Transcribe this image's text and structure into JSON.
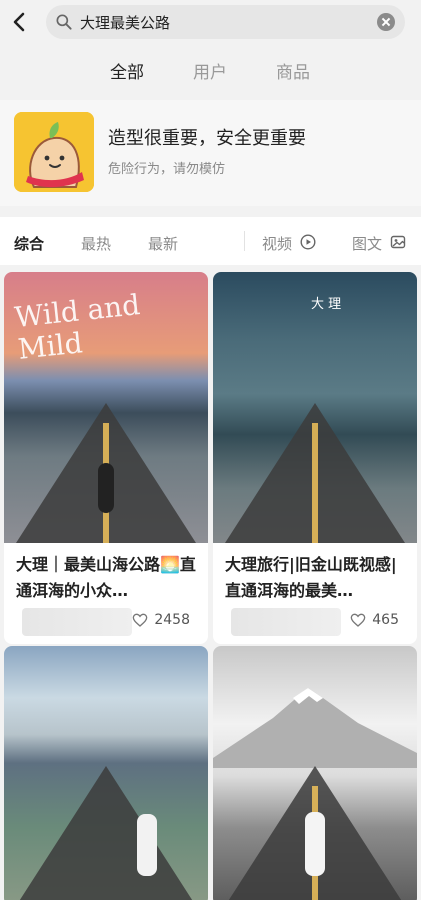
{
  "search": {
    "query": "大理最美公路"
  },
  "tabs": {
    "all": "全部",
    "users": "用户",
    "products": "商品"
  },
  "promo": {
    "title": "造型很重要，安全更重要",
    "subtitle": "危险行为，请勿模仿"
  },
  "filters": {
    "comprehensive": "综合",
    "hottest": "最热",
    "newest": "最新",
    "video": "视频",
    "image_text": "图文"
  },
  "cards": [
    {
      "title": "大理｜最美山海公路🌅直通洱海的小众…",
      "likes": "2458",
      "overlay_title": "Wild and Mild"
    },
    {
      "title": "大理旅行|旧金山既视感|直通洱海的最美…",
      "likes": "465",
      "overlay_title": "大 理"
    },
    {
      "title": "",
      "likes": ""
    },
    {
      "title": "",
      "likes": ""
    }
  ],
  "colors": {
    "accent": "#ff2e4d",
    "bg": "#f2f2f2"
  },
  "icons": {
    "back": "chevron-left-icon",
    "search": "search-icon",
    "clear": "clear-icon",
    "video": "play-circle-icon",
    "image_text": "image-icon",
    "like": "heart-icon"
  }
}
